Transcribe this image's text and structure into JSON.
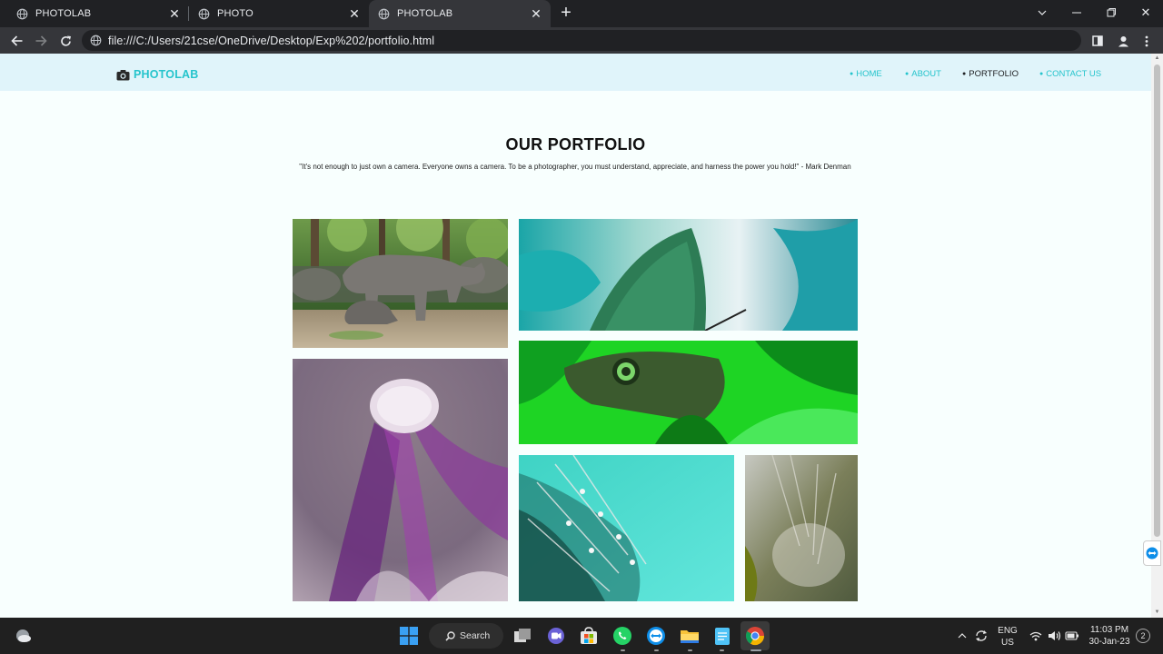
{
  "browser": {
    "tabs": [
      {
        "title": "PHOTOLAB",
        "active": false
      },
      {
        "title": "PHOTO",
        "active": false
      },
      {
        "title": "PHOTOLAB",
        "active": true
      }
    ],
    "url": "file:///C:/Users/21cse/OneDrive/Desktop/Exp%202/portfolio.html"
  },
  "site": {
    "brand": "PHOTOLAB",
    "nav": [
      {
        "label": "HOME",
        "current": false
      },
      {
        "label": "ABOUT",
        "current": false
      },
      {
        "label": "PORTFOLIO",
        "current": true
      },
      {
        "label": "CONTACT US",
        "current": false
      }
    ],
    "heading": "OUR PORTFOLIO",
    "quote": "\"It's not enough to just own a camera. Everyone owns a camera. To be a photographer, you must understand, appreciate, and harness the power you hold!\" - Mark Denman",
    "photos": [
      "rhinoceros",
      "teal-butterfly",
      "green-butterfly",
      "purple-dandelion",
      "teal-dewdrops-dandelion",
      "dandelion-seeds"
    ]
  },
  "taskbar": {
    "search_label": "Search",
    "language": "ENG",
    "region": "US",
    "time": "11:03 PM",
    "date": "30-Jan-23",
    "notification_count": "2"
  },
  "colors": {
    "accent": "#25c4cc",
    "nav_bg": "#e0f4fa",
    "page_bg": "#f8fffe"
  }
}
